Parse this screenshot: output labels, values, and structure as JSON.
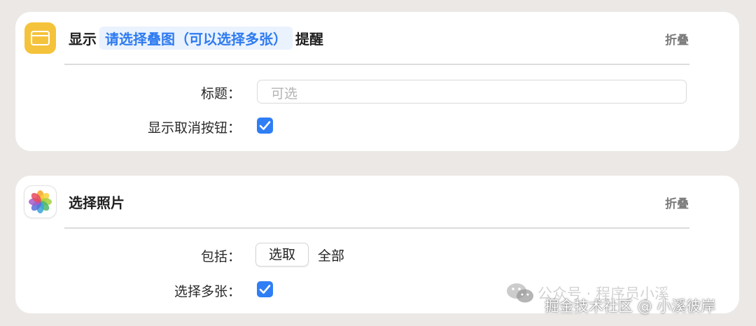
{
  "alert_card": {
    "title_prefix": "显示",
    "title_token": "请选择叠图（可以选择多张）",
    "title_suffix": "提醒",
    "collapse_label": "折叠",
    "title_field_label": "标题：",
    "title_field_placeholder": "可选",
    "cancel_button_label": "显示取消按钮：",
    "cancel_button_checked": true,
    "icon": "alert-window-icon",
    "accent": "#F5C33B"
  },
  "photo_card": {
    "title": "选择照片",
    "collapse_label": "折叠",
    "include_label": "包括：",
    "select_button_label": "选取",
    "include_value": "全部",
    "multi_select_label": "选择多张：",
    "multi_select_checked": true,
    "icon": "photos-app-icon"
  },
  "watermark": {
    "line1": "公众号 · 程序员小溪",
    "line2": "掘金技术社区 @ 小溪彼岸",
    "icon": "wechat-icon"
  },
  "colors": {
    "checkbox": "#2F7EF5",
    "token_text": "#2E7BF0",
    "background": "#EBE8E5"
  }
}
